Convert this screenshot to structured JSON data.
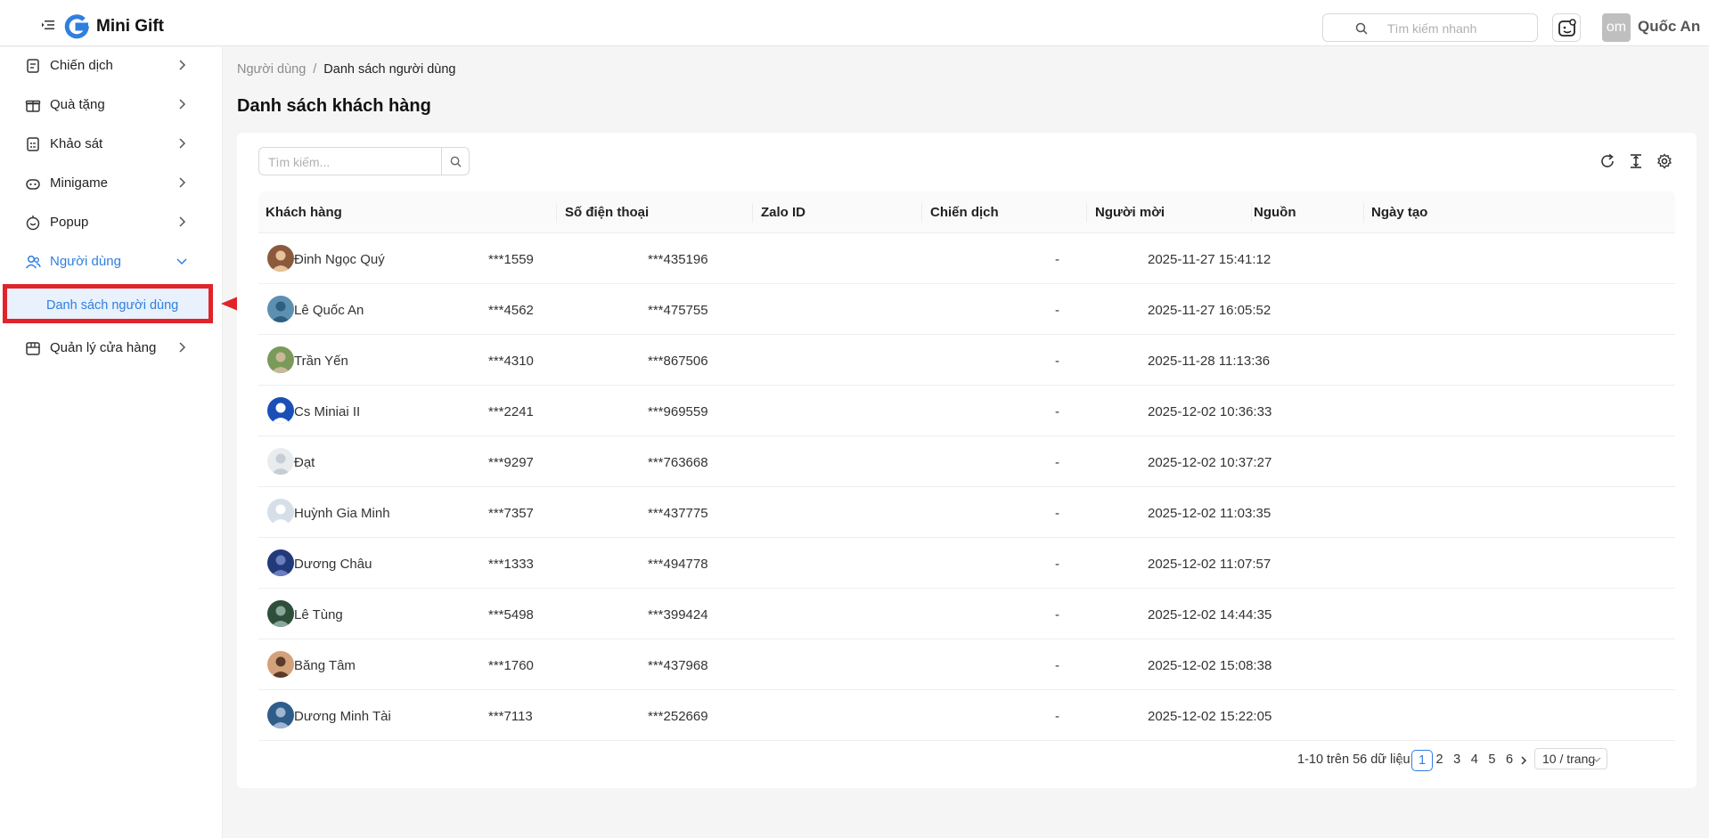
{
  "header": {
    "brand": "Mini Gift",
    "search_placeholder": "Tìm kiếm nhanh",
    "user_initials": "om",
    "user_name": "Quốc An"
  },
  "sidebar": {
    "items": [
      {
        "label": "Chiến dịch",
        "icon": "campaign-icon"
      },
      {
        "label": "Quà tặng",
        "icon": "gift-icon"
      },
      {
        "label": "Khảo sát",
        "icon": "survey-icon"
      },
      {
        "label": "Minigame",
        "icon": "game-icon"
      },
      {
        "label": "Popup",
        "icon": "popup-icon"
      },
      {
        "label": "Người dùng",
        "icon": "users-icon",
        "expanded": true
      },
      {
        "label": "Quản lý cửa hàng",
        "icon": "store-icon"
      }
    ],
    "subitem": "Danh sách người dùng"
  },
  "breadcrumb": {
    "parent": "Người dùng",
    "current": "Danh sách người dùng"
  },
  "page_title": "Danh sách khách hàng",
  "table": {
    "search_placeholder": "Tìm kiếm...",
    "columns": [
      "Khách hàng",
      "Số điện thoại",
      "Zalo ID",
      "Chiến dịch",
      "Người mời",
      "Nguồn",
      "Ngày tạo"
    ],
    "rows": [
      {
        "name": "Đinh Ngọc Quý",
        "phone": "***1559",
        "zalo": "***435196",
        "campaign": "",
        "inviter": "",
        "source": "-",
        "created": "2025-11-27 15:41:12"
      },
      {
        "name": "Lê Quốc An",
        "phone": "***4562",
        "zalo": "***475755",
        "campaign": "",
        "inviter": "",
        "source": "-",
        "created": "2025-11-27 16:05:52"
      },
      {
        "name": "Trần Yến",
        "phone": "***4310",
        "zalo": "***867506",
        "campaign": "",
        "inviter": "",
        "source": "-",
        "created": "2025-11-28 11:13:36"
      },
      {
        "name": "Cs Miniai II",
        "phone": "***2241",
        "zalo": "***969559",
        "campaign": "",
        "inviter": "",
        "source": "-",
        "created": "2025-12-02 10:36:33"
      },
      {
        "name": "Đạt",
        "phone": "***9297",
        "zalo": "***763668",
        "campaign": "",
        "inviter": "",
        "source": "-",
        "created": "2025-12-02 10:37:27"
      },
      {
        "name": "Huỳnh Gia Minh",
        "phone": "***7357",
        "zalo": "***437775",
        "campaign": "",
        "inviter": "",
        "source": "-",
        "created": "2025-12-02 11:03:35"
      },
      {
        "name": "Dương Châu",
        "phone": "***1333",
        "zalo": "***494778",
        "campaign": "",
        "inviter": "",
        "source": "-",
        "created": "2025-12-02 11:07:57"
      },
      {
        "name": "Lê Tùng",
        "phone": "***5498",
        "zalo": "***399424",
        "campaign": "",
        "inviter": "",
        "source": "-",
        "created": "2025-12-02 14:44:35"
      },
      {
        "name": "Băng Tâm",
        "phone": "***1760",
        "zalo": "***437968",
        "campaign": "",
        "inviter": "",
        "source": "-",
        "created": "2025-12-02 15:08:38"
      },
      {
        "name": "Dương Minh Tài",
        "phone": "***7113",
        "zalo": "***252669",
        "campaign": "",
        "inviter": "",
        "source": "-",
        "created": "2025-12-02 15:22:05"
      }
    ]
  },
  "pagination": {
    "total_text": "1-10 trên 56 dữ liệu",
    "pages": [
      "1",
      "2",
      "3",
      "4",
      "5",
      "6"
    ],
    "current": "1",
    "page_size": "10 / trang"
  },
  "colors": {
    "accent": "#2f7fe0",
    "annotation": "#e0242a"
  }
}
